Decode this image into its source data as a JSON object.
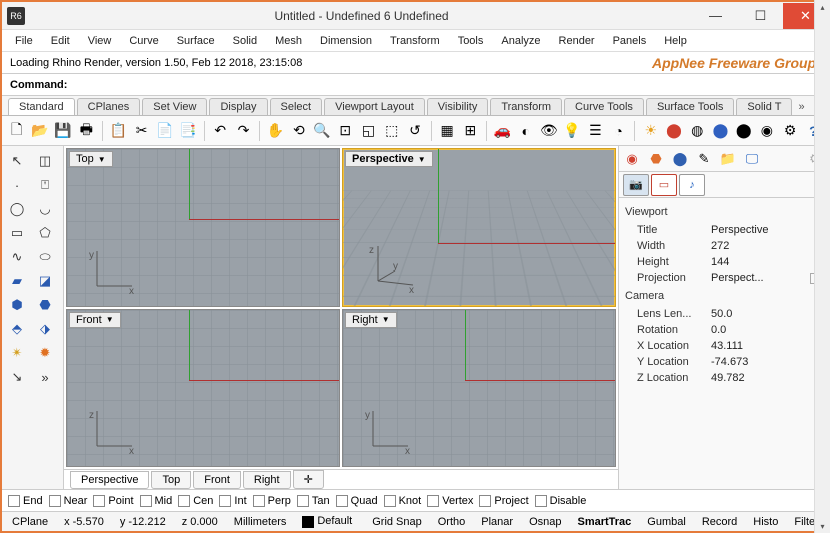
{
  "window": {
    "title": "Untitled - Undefined 6 Undefined"
  },
  "menu": [
    "File",
    "Edit",
    "View",
    "Curve",
    "Surface",
    "Solid",
    "Mesh",
    "Dimension",
    "Transform",
    "Tools",
    "Analyze",
    "Render",
    "Panels",
    "Help"
  ],
  "status_msg": "Loading Rhino Render, version 1.50, Feb 12 2018, 23:15:08",
  "watermark": "AppNee Freeware Group.",
  "command_label": "Command:",
  "command_value": "",
  "tool_tabs": [
    "Standard",
    "CPlanes",
    "Set View",
    "Display",
    "Select",
    "Viewport Layout",
    "Visibility",
    "Transform",
    "Curve Tools",
    "Surface Tools",
    "Solid T"
  ],
  "active_tool_tab": "Standard",
  "viewports": {
    "top": {
      "label": "Top",
      "axes": [
        "x",
        "y"
      ]
    },
    "perspective": {
      "label": "Perspective",
      "axes": [
        "x",
        "y",
        "z"
      ]
    },
    "front": {
      "label": "Front",
      "axes": [
        "x",
        "z"
      ]
    },
    "right": {
      "label": "Right",
      "axes": [
        "x",
        "y"
      ]
    }
  },
  "vp_tabs": [
    "Perspective",
    "Top",
    "Front",
    "Right"
  ],
  "active_vp_tab": "Perspective",
  "properties": {
    "section1": "Viewport",
    "title_k": "Title",
    "title_v": "Perspective",
    "width_k": "Width",
    "width_v": "272",
    "height_k": "Height",
    "height_v": "144",
    "proj_k": "Projection",
    "proj_v": "Perspect...",
    "section2": "Camera",
    "lens_k": "Lens Len...",
    "lens_v": "50.0",
    "rot_k": "Rotation",
    "rot_v": "0.0",
    "xloc_k": "X Location",
    "xloc_v": "43.111",
    "yloc_k": "Y Location",
    "yloc_v": "-74.673",
    "zloc_k": "Z Location",
    "zloc_v": "49.782"
  },
  "osnaps": [
    "End",
    "Near",
    "Point",
    "Mid",
    "Cen",
    "Int",
    "Perp",
    "Tan",
    "Quad",
    "Knot",
    "Vertex",
    "Project",
    "Disable"
  ],
  "statusbar": {
    "cplane": "CPlane",
    "x": "x -5.570",
    "y": "y -12.212",
    "z": "z 0.000",
    "units": "Millimeters",
    "layer": "Default",
    "toggles": [
      "Grid Snap",
      "Ortho",
      "Planar",
      "Osnap",
      "SmartTrac",
      "Gumbal",
      "Record",
      "Histo",
      "Filter"
    ],
    "active_toggle": "SmartTrac"
  }
}
